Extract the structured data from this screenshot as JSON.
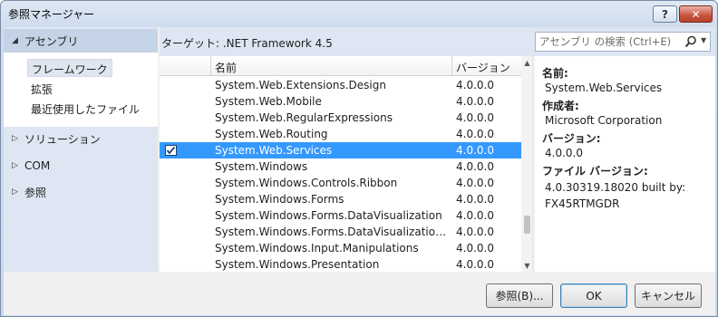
{
  "window": {
    "title": "参照マネージャー",
    "help_label": "?",
    "close_label": "✕"
  },
  "nav": {
    "assemblies_label": "アセンブリ",
    "assemblies_sub": [
      "フレームワーク",
      "拡張",
      "最近使用したファイル"
    ],
    "solution_label": "ソリューション",
    "com_label": "COM",
    "browse_label": "参照"
  },
  "topbar": {
    "target_label": "ターゲット: .NET Framework 4.5",
    "search_placeholder": "アセンブリ の検索 (Ctrl+E)"
  },
  "grid": {
    "col_name": "名前",
    "col_version": "バージョン",
    "rows": [
      {
        "name": "System.Web.Extensions.Design",
        "version": "4.0.0.0",
        "selected": false
      },
      {
        "name": "System.Web.Mobile",
        "version": "4.0.0.0",
        "selected": false
      },
      {
        "name": "System.Web.RegularExpressions",
        "version": "4.0.0.0",
        "selected": false
      },
      {
        "name": "System.Web.Routing",
        "version": "4.0.0.0",
        "selected": false
      },
      {
        "name": "System.Web.Services",
        "version": "4.0.0.0",
        "selected": true
      },
      {
        "name": "System.Windows",
        "version": "4.0.0.0",
        "selected": false
      },
      {
        "name": "System.Windows.Controls.Ribbon",
        "version": "4.0.0.0",
        "selected": false
      },
      {
        "name": "System.Windows.Forms",
        "version": "4.0.0.0",
        "selected": false
      },
      {
        "name": "System.Windows.Forms.DataVisualization",
        "version": "4.0.0.0",
        "selected": false
      },
      {
        "name": "System.Windows.Forms.DataVisualization…",
        "version": "4.0.0.0",
        "selected": false
      },
      {
        "name": "System.Windows.Input.Manipulations",
        "version": "4.0.0.0",
        "selected": false
      },
      {
        "name": "System.Windows.Presentation",
        "version": "4.0.0.0",
        "selected": false
      }
    ]
  },
  "details": {
    "name_label": "名前:",
    "name_value": "System.Web.Services",
    "author_label": "作成者:",
    "author_value": "Microsoft Corporation",
    "version_label": "バージョン:",
    "version_value": "4.0.0.0",
    "file_version_label": "ファイル バージョン:",
    "file_version_value": "4.0.30319.18020 built by: FX45RTMGDR"
  },
  "buttons": {
    "browse": "参照(B)...",
    "ok": "OK",
    "cancel": "キャンセル"
  }
}
